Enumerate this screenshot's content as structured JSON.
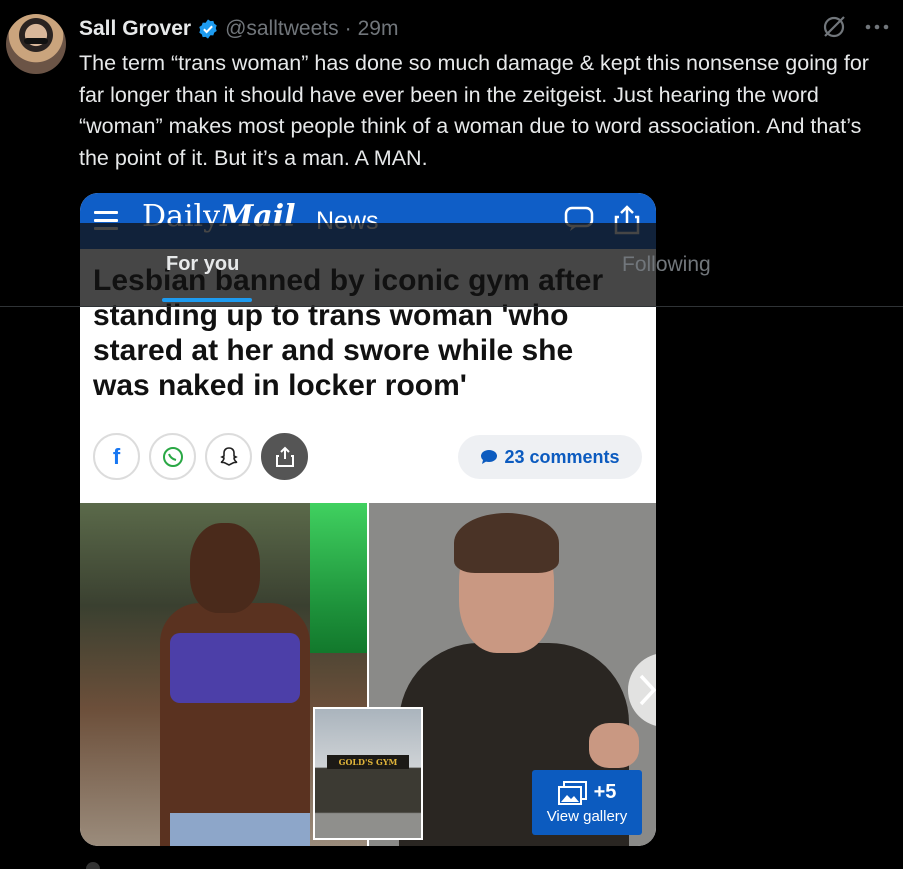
{
  "tweet": {
    "name": "Sall Grover",
    "handle": "@salltweets",
    "separator": "·",
    "time": "29m",
    "text": "The term “trans woman” has done so much damage & kept this nonsense going for far longer than it should have ever been in the zeitgeist. Just hearing the word “woman” makes most people think of a woman due to word association. And that’s the point of it. But it’s a man. A MAN."
  },
  "media": {
    "site_logo_light": "Daily",
    "site_logo_bold": "Mail",
    "site_section": "News",
    "headline": "Lesbian banned by iconic gym after standing up to trans woman 'who stared at her and swore while she was naked in locker room'",
    "comments_count": "23 comments",
    "gym_sign": "GOLD'S GYM",
    "gallery_count": "+5",
    "gallery_label": "View gallery",
    "share_icons": [
      "facebook-icon",
      "whatsapp-icon",
      "snapchat-icon",
      "share-icon"
    ]
  },
  "tabs": {
    "for_you": "For you",
    "following": "Following"
  },
  "colors": {
    "background": "#000000",
    "accent": "#1d9bf0",
    "daily_mail_blue": "#0f5ec7",
    "muted": "#71767b"
  }
}
